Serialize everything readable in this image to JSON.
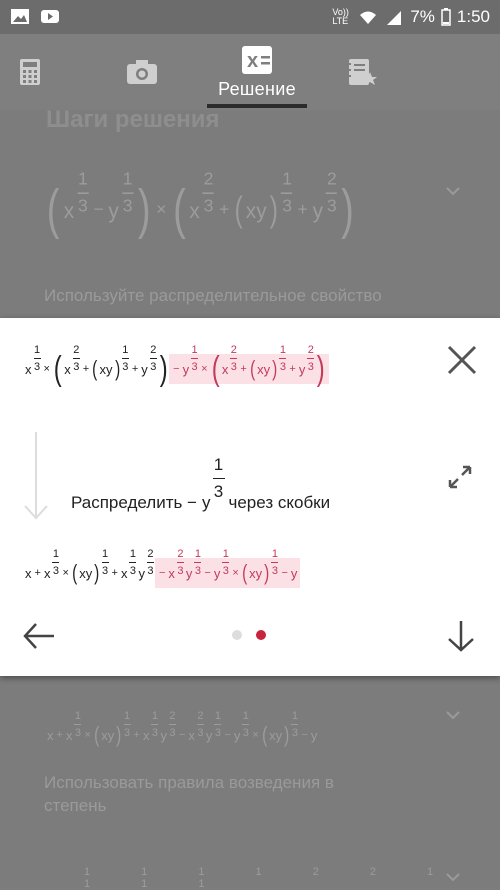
{
  "status_bar": {
    "signal_label": "Vo)) LTE",
    "battery": "7%",
    "time": "1:50"
  },
  "tabs": [
    {
      "name": "calculator",
      "label": ""
    },
    {
      "name": "camera",
      "label": ""
    },
    {
      "name": "solution",
      "label": "Решение",
      "active": true
    },
    {
      "name": "notes",
      "label": ""
    }
  ],
  "background": {
    "steps_title": "Шаги решения",
    "step1_instruction": "Используйте распределительное свойство",
    "step3_instruction_line1": "Использовать правила возведения в",
    "step3_instruction_line2": "степень"
  },
  "dialog": {
    "step_description_prefix": "Распределить −",
    "step_description_var": "y",
    "step_description_num": "1",
    "step_description_den": "3",
    "step_description_suffix": "через скобки",
    "current_step": 2,
    "total_steps": 2
  },
  "colors": {
    "highlight_bg": "#fbe1e6",
    "highlight_text": "#c33a5a",
    "active_dot": "#c7253e"
  }
}
